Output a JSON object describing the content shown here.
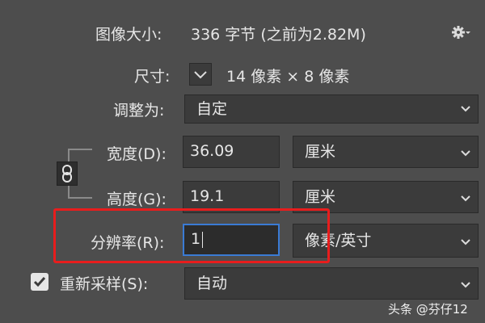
{
  "image_size": {
    "label": "图像大小:",
    "value": "336 字节 (之前为2.82M)"
  },
  "dimensions": {
    "label": "尺寸:",
    "value": "14 像素 × 8 像素"
  },
  "fit_to": {
    "label": "调整为:",
    "selected": "自定"
  },
  "width": {
    "label": "宽度(D):",
    "value": "36.09",
    "unit": "厘米"
  },
  "height": {
    "label": "高度(G):",
    "value": "19.1",
    "unit": "厘米"
  },
  "resolution": {
    "label": "分辨率(R):",
    "value": "1",
    "unit": "像素/英寸"
  },
  "resample": {
    "label": "重新采样(S):",
    "checked": true,
    "selected": "自动"
  },
  "watermark": {
    "text": "头条 @芬仔12"
  },
  "colors": {
    "background": "#4d4d4d",
    "field": "#3b3b3b",
    "focus": "#3a7bd5",
    "highlight": "#e81d1d"
  }
}
